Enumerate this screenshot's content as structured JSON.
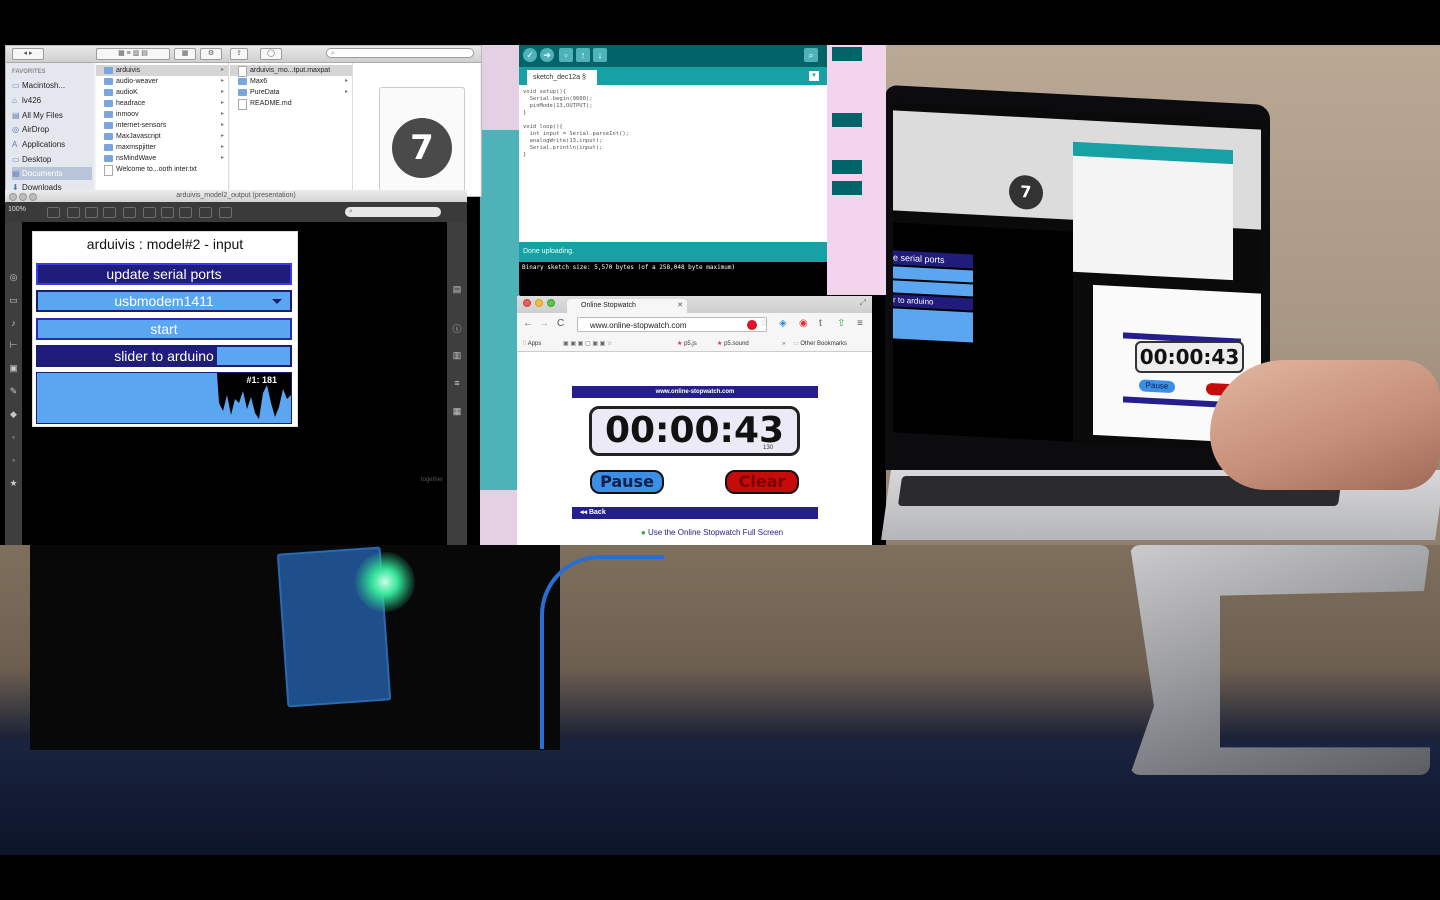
{
  "finder": {
    "favorites_label": "FAVORITES",
    "favorites": [
      "Macintosh...",
      "lv426",
      "All My Files",
      "AirDrop",
      "Applications",
      "Desktop",
      "Documents",
      "Downloads"
    ],
    "column1": [
      "arduivis",
      "audio-weaver",
      "audioK",
      "headrace",
      "inmoov",
      "internet-sensors",
      "MaxJavascript",
      "maxmspjitter",
      "nsMindWave",
      "Welcome to...ooth inter.txt"
    ],
    "column2": [
      "arduivis_mo...tput.maxpat",
      "Max6",
      "PureData",
      "README.md"
    ]
  },
  "max": {
    "window_title": "arduivis_model2_output (presentation)",
    "zoom": "100%",
    "panel_title": "arduivis : model#2 - input",
    "update_button": "update serial ports",
    "port_menu_value": "usbmodem1411",
    "start_button": "start",
    "slider_label": "slider to arduino",
    "slider_value": 0.71,
    "scope_label": "#1: 181",
    "bottom_hint": "together"
  },
  "arduino": {
    "tab": "sketch_dec12a §",
    "code": "void setup(){\n  Serial.begin(9600);\n  pinMode(13,OUTPUT);\n}\n\nvoid loop(){\n  int input = Serial.parseInt();\n  analogWrite(13,input);\n  Serial.println(input);\n}",
    "status": "Done uploading.",
    "console": "Binary sketch size: 5,570 bytes (of a 258,048 byte maximum)"
  },
  "browser": {
    "tab_title": "Online Stopwatch",
    "url": "www.online-stopwatch.com",
    "bookmarks": [
      "Apps",
      "p5.js",
      "p5.sound",
      "Other Bookmarks"
    ],
    "banner": "www.online-stopwatch.com",
    "time": "00:00:43",
    "ms": "130",
    "pause_label": "Pause",
    "clear_label": "Clear",
    "back_label": "Back",
    "fullscreen_link": "Use the Online Stopwatch Full Screen"
  },
  "laptop": {
    "mirror_time": "00:00:43",
    "mirror_update": "e serial ports",
    "mirror_slider": "r to arduino",
    "mirror_pause": "Pause"
  },
  "colors": {
    "max_dark_blue": "#201c7b",
    "max_light_blue": "#5aa6f0",
    "arduino_teal": "#17a1a5",
    "stopwatch_banner": "#241f8c",
    "pause_blue": "#3b8fe6",
    "clear_red": "#c60b0b"
  }
}
